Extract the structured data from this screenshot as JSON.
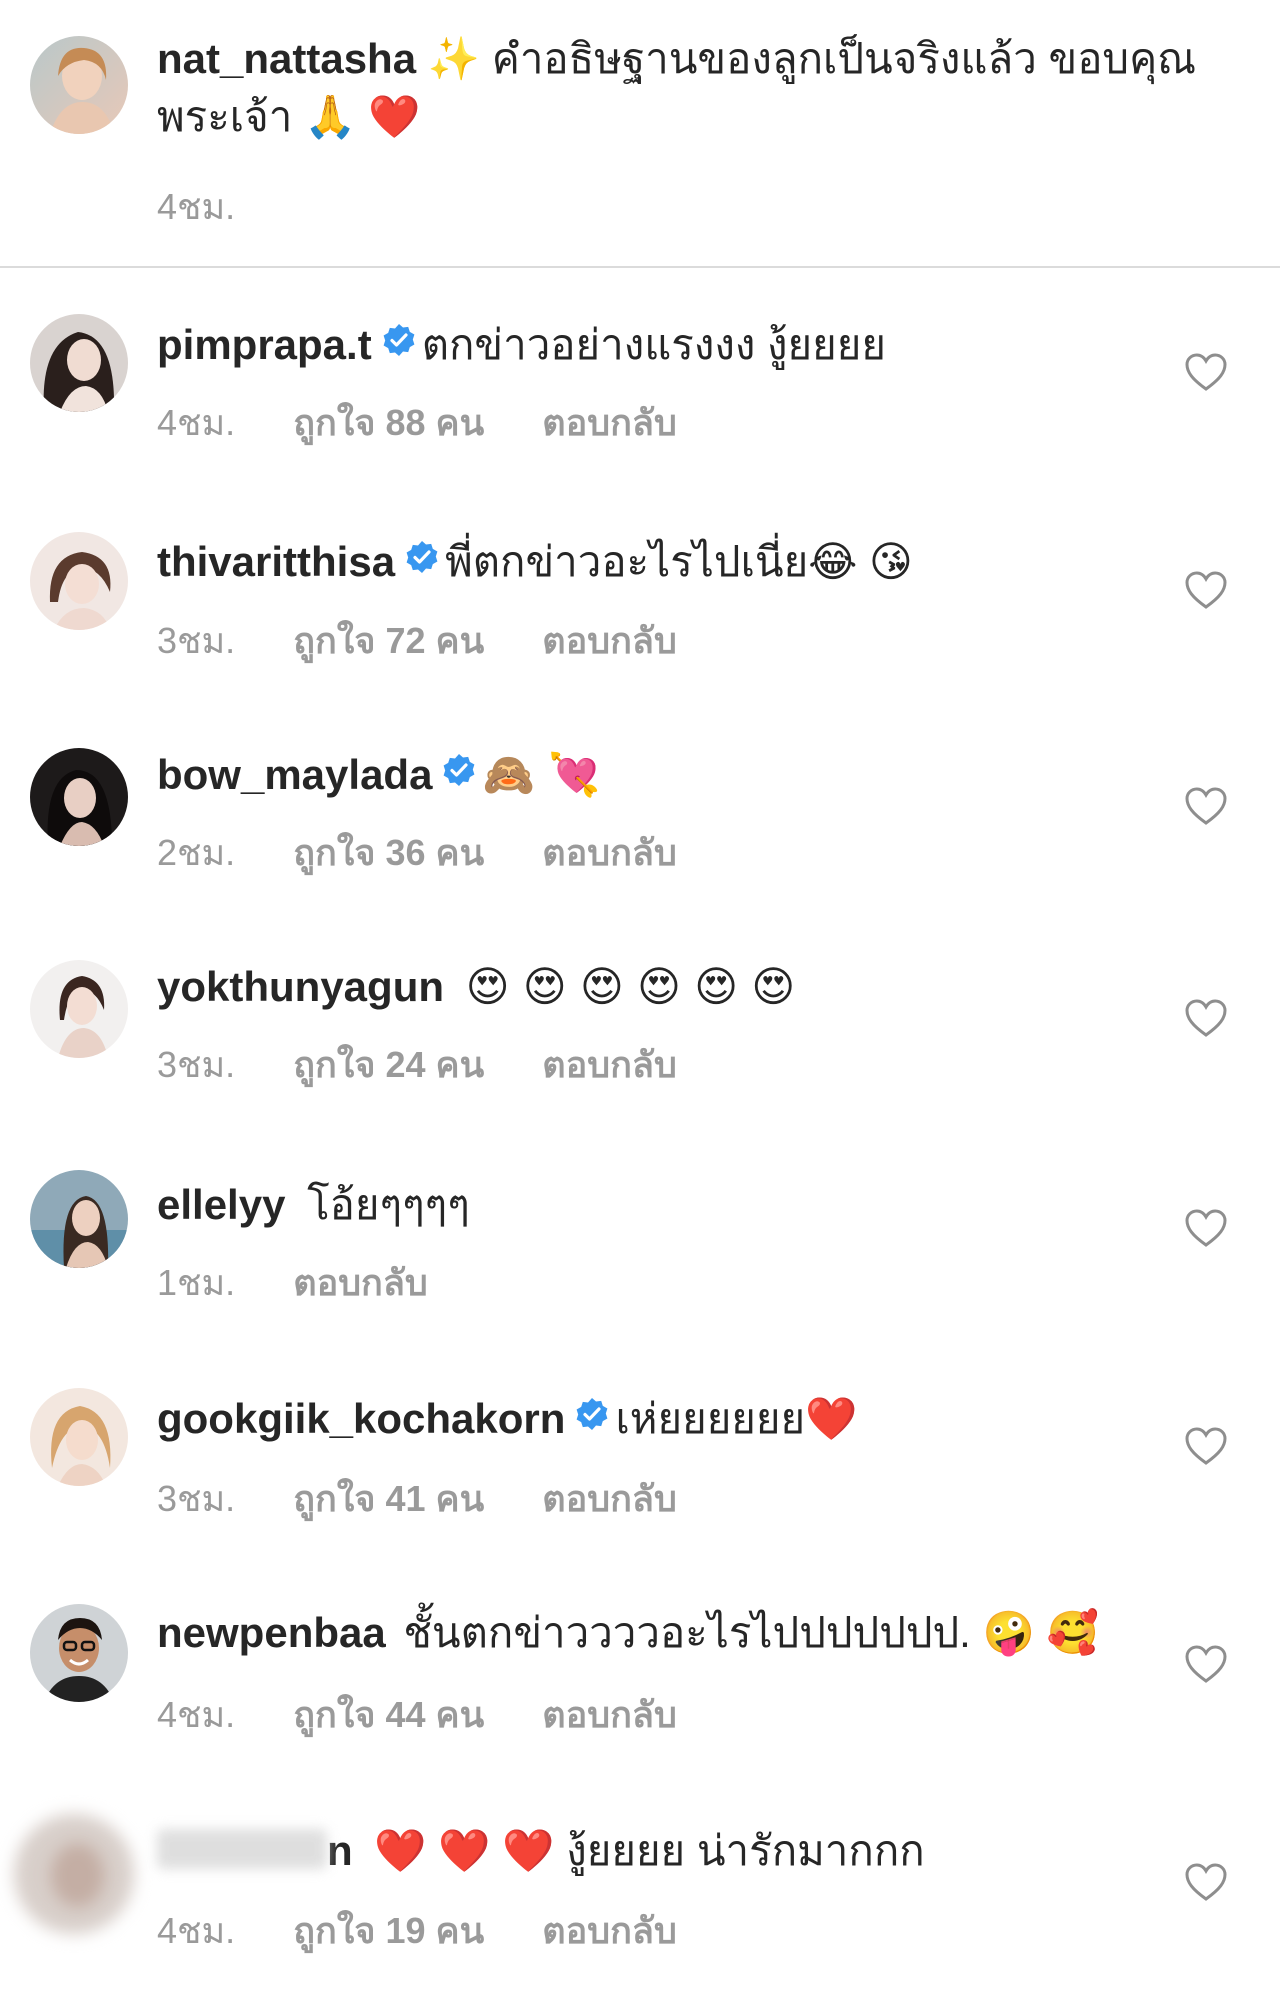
{
  "caption": {
    "username": "nat_nattasha",
    "emoji_sparkles": "✨",
    "text_line1": "คำอธิษฐานของลูกเป็นจริงแล้ว  ขอบคุณ",
    "text_line2": "พระเจ้า",
    "emoji_pray": "🙏",
    "emoji_heart": "❤️",
    "time": "4ชม."
  },
  "comments": [
    {
      "username": "pimprapa.t",
      "text": "ตกข่าวอย่างแรงงง งู้ยยยย",
      "time": "4ชม.",
      "likes": "ถูกใจ 88 คน",
      "reply": "ตอบกลับ"
    },
    {
      "username": "thivaritthisa",
      "text": "พี่ตกข่าวอะไรไปเนี่ย😂 😘",
      "time": "3ชม.",
      "likes": "ถูกใจ 72 คน",
      "reply": "ตอบกลับ"
    },
    {
      "username": "bow_maylada",
      "text": "🙈 💘",
      "time": "2ชม.",
      "likes": "ถูกใจ 36 คน",
      "reply": "ตอบกลับ"
    },
    {
      "username": "yokthunyagun",
      "text": "😍 😍 😍 😍 😍 😍",
      "time": "3ชม.",
      "likes": "ถูกใจ 24 คน",
      "reply": "ตอบกลับ"
    },
    {
      "username": "ellelyy",
      "text": "โอ้ยๆๆๆๆ",
      "time": "1ชม.",
      "reply": "ตอบกลับ"
    },
    {
      "username": "gookgiik_kochakorn",
      "text": "เห่ยยยยยย❤️",
      "time": "3ชม.",
      "likes": "ถูกใจ 41 คน",
      "reply": "ตอบกลับ"
    },
    {
      "username": "newpenbaa",
      "text": "ชั้นตกข่าววววอะไรไปปปปปปป. 🤪 🥰",
      "time": "4ชม.",
      "likes": "ถูกใจ 44 คน",
      "reply": "ตอบกลับ"
    },
    {
      "username_suffix": "n",
      "text": "❤️ ❤️ ❤️  งู้ยยยย น่ารักมากกก",
      "time": "4ชม.",
      "likes": "ถูกใจ 19 คน",
      "reply": "ตอบกลับ"
    }
  ],
  "colors": {
    "text": "#262626",
    "meta": "#9a9a9a",
    "verified": "#3897f0",
    "divider": "#dbdbdb"
  },
  "icons": {
    "verified": "verified-badge-icon",
    "like": "heart-outline-icon"
  }
}
